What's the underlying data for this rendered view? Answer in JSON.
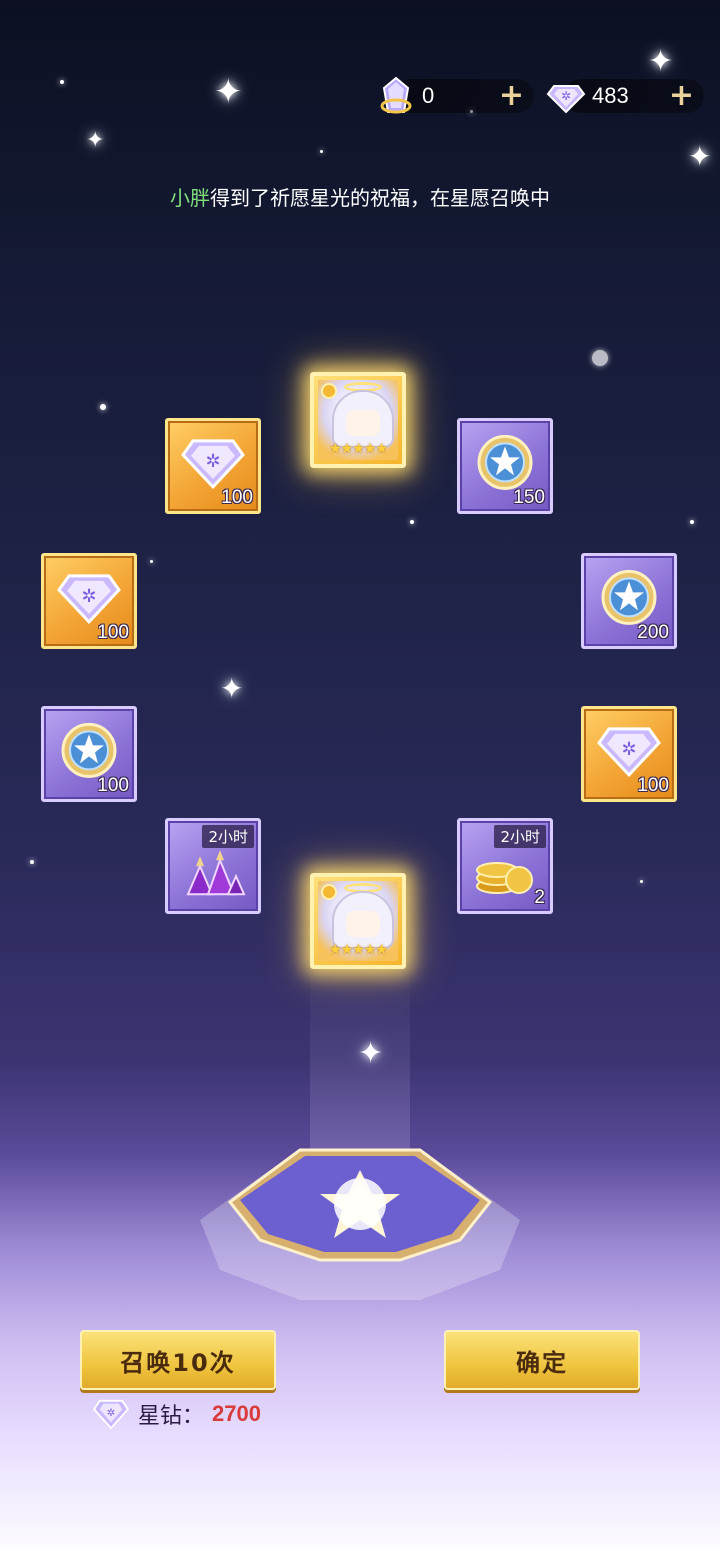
{
  "currencies": [
    {
      "name": "wish-crystal",
      "value": "0"
    },
    {
      "name": "star-diamond",
      "value": "483"
    }
  ],
  "banner": {
    "player": "小胖",
    "message": "得到了祈愿星光的祝福，在星愿召唤中"
  },
  "rewards": [
    {
      "kind": "hero",
      "label": ""
    },
    {
      "kind": "diamond",
      "count": "100"
    },
    {
      "kind": "medal",
      "count": "150"
    },
    {
      "kind": "diamond",
      "count": "100"
    },
    {
      "kind": "medal",
      "count": "200"
    },
    {
      "kind": "medal",
      "count": "100"
    },
    {
      "kind": "diamond",
      "count": "100"
    },
    {
      "kind": "potion",
      "tag": "2小时"
    },
    {
      "kind": "gold",
      "tag": "2小时",
      "count": "2"
    },
    {
      "kind": "hero",
      "label": ""
    }
  ],
  "hero_stars": "★★★★★",
  "buttons": {
    "summon_10": "召唤10次",
    "confirm": "确定"
  },
  "cost": {
    "label": "星钻：",
    "value": "2700"
  },
  "colors": {
    "gold_tile": "#f3a535",
    "purple_tile": "#8d74d8",
    "button": "#efc43f",
    "cost_value": "#d93a3a",
    "player_name": "#7ee07a"
  }
}
